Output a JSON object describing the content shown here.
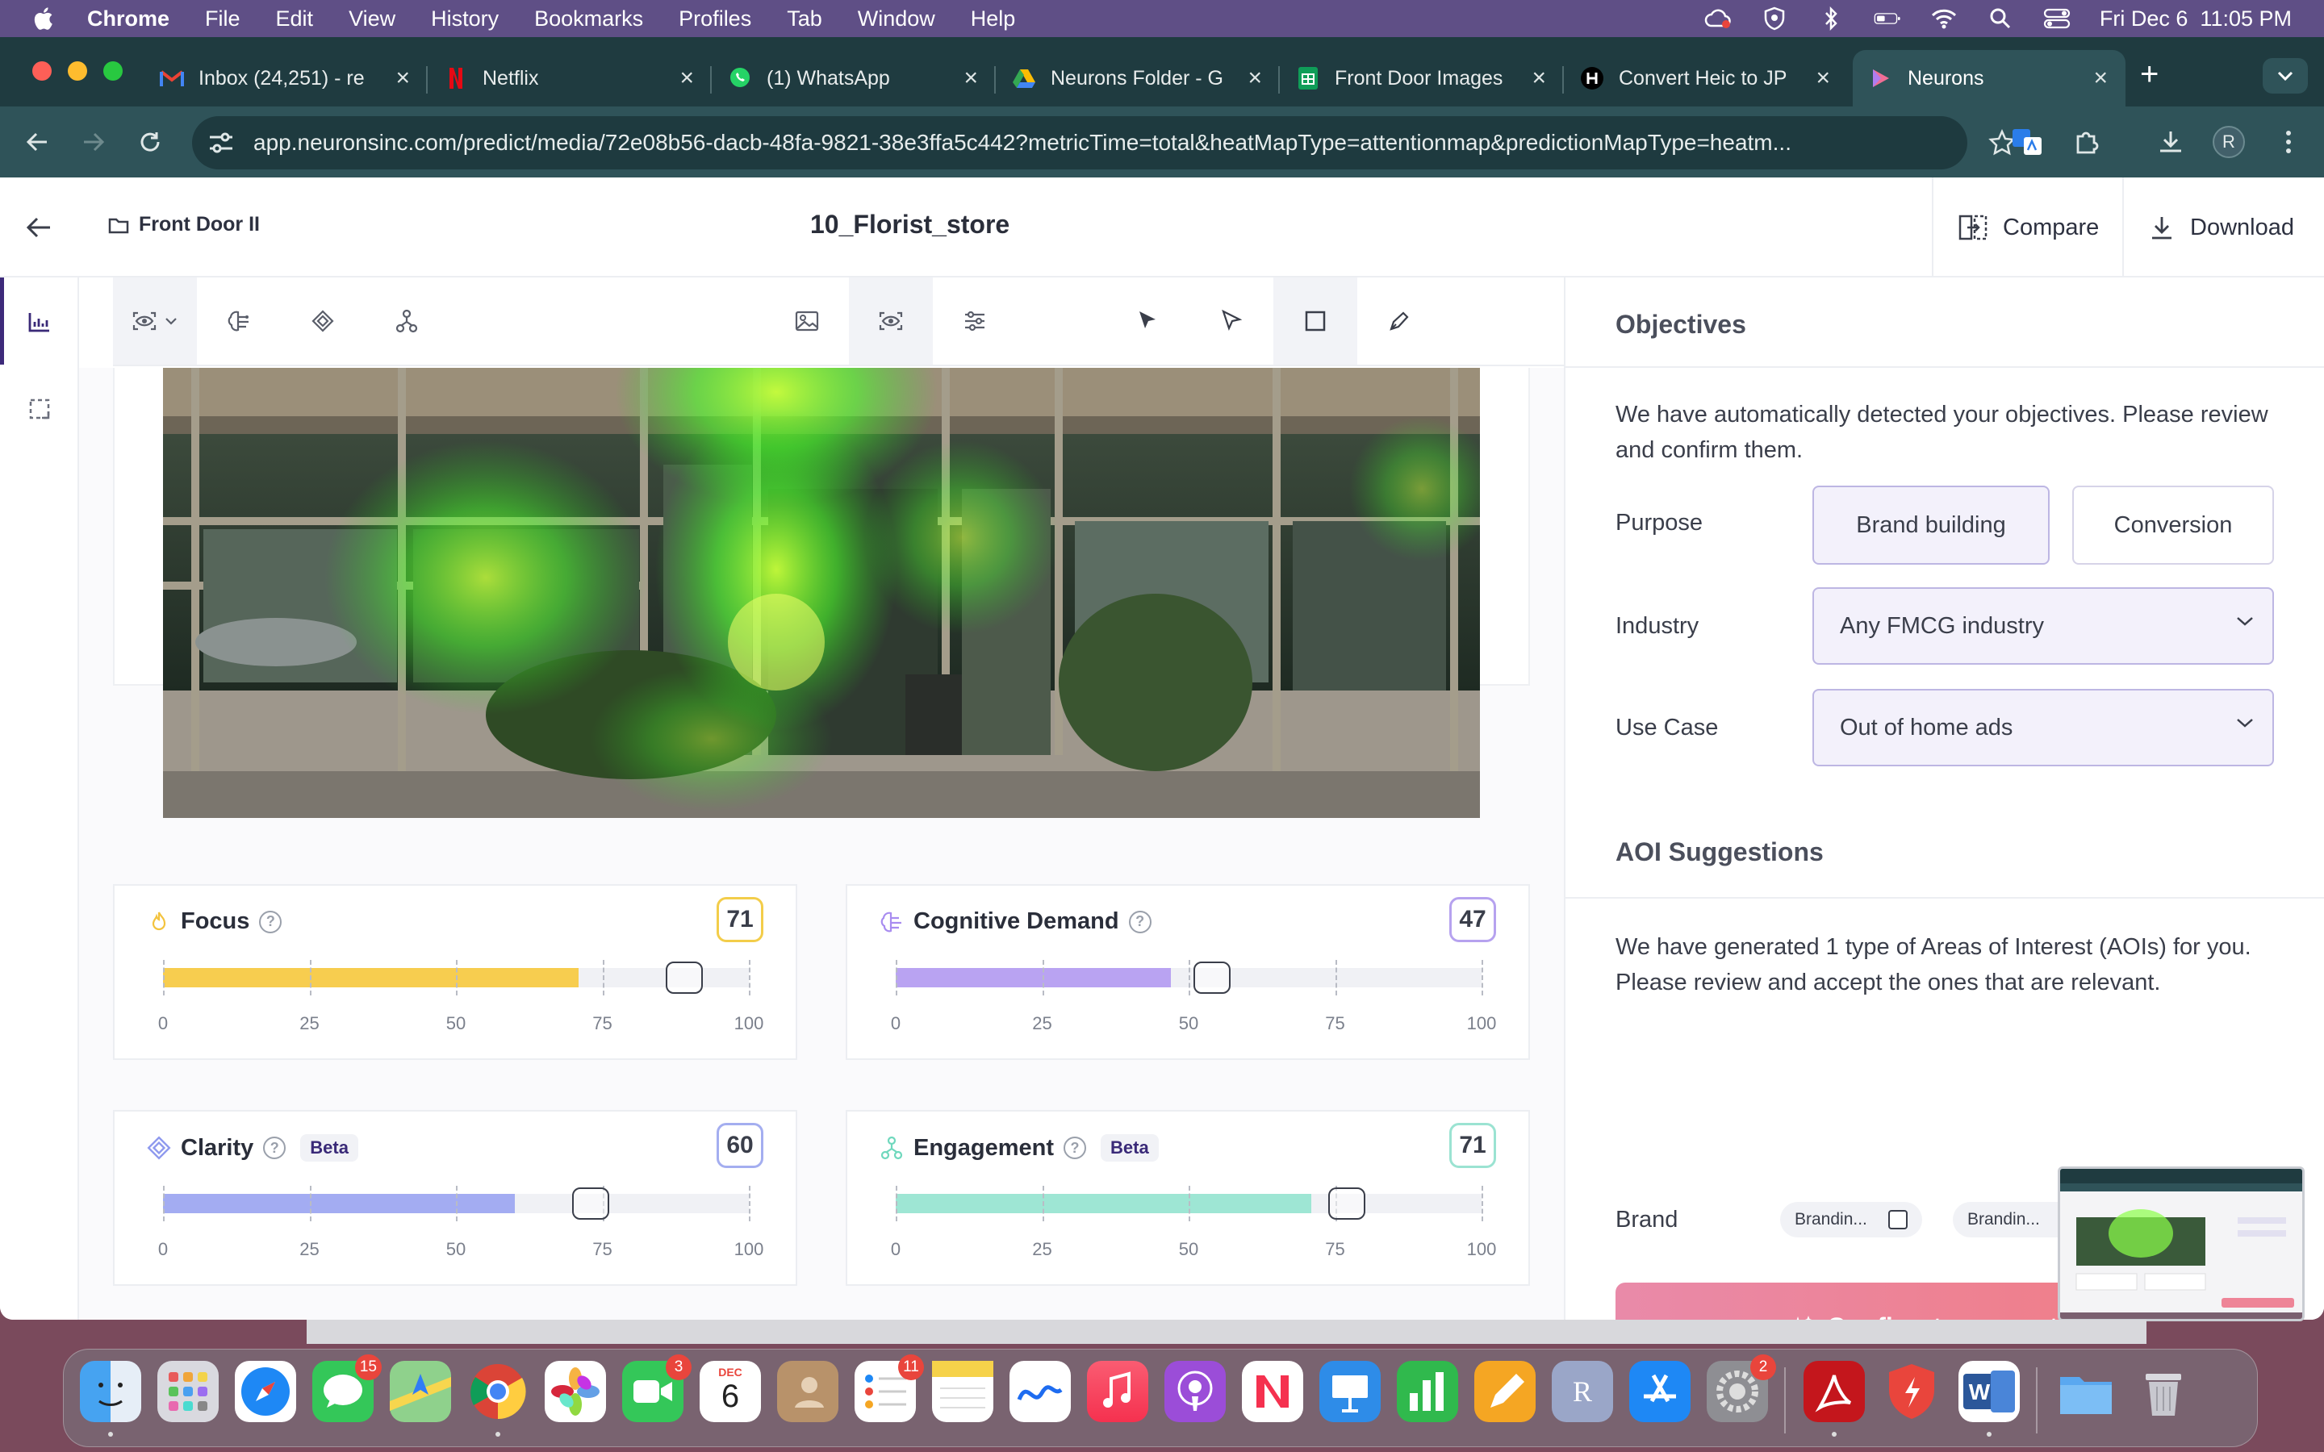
{
  "menubar": {
    "items": [
      "Chrome",
      "File",
      "Edit",
      "View",
      "History",
      "Bookmarks",
      "Profiles",
      "Tab",
      "Window",
      "Help"
    ],
    "clock": "Fri Dec 6  11:05 PM"
  },
  "tabs": [
    {
      "title": "Inbox (24,251) - re",
      "icon": "gmail-icon"
    },
    {
      "title": "Netflix",
      "icon": "netflix-icon"
    },
    {
      "title": "(1) WhatsApp",
      "icon": "whatsapp-icon"
    },
    {
      "title": "Neurons Folder - G",
      "icon": "google-drive-icon"
    },
    {
      "title": "Front Door Images",
      "icon": "google-sheets-icon"
    },
    {
      "title": "Convert Heic to JP",
      "icon": "heic-icon"
    },
    {
      "title": "Neurons",
      "icon": "neurons-icon"
    }
  ],
  "omnibox": {
    "url": "app.neuronsinc.com/predict/media/72e08b56-dacb-48fa-9821-38e3ffa5c442?metricTime=total&heatMapType=attentionmap&predictionMapType=heatm..."
  },
  "profile_initial": "R",
  "header": {
    "breadcrumb": "Front Door II",
    "title": "10_Florist_store",
    "compare_label": "Compare",
    "download_label": "Download"
  },
  "metrics": [
    {
      "name": "Focus",
      "score": "71",
      "value": 71,
      "handle": 89,
      "beta": "",
      "color": "#f7cd4f",
      "border": "#f3cd4a"
    },
    {
      "name": "Cognitive Demand",
      "score": "47",
      "value": 47,
      "handle": 54,
      "beta": "",
      "color": "#b9a3f2",
      "border": "#b6a2ef"
    },
    {
      "name": "Clarity",
      "score": "60",
      "value": 60,
      "handle": 73,
      "beta": "Beta",
      "color": "#a3acf2",
      "border": "#a4aef0"
    },
    {
      "name": "Engagement",
      "score": "71",
      "value": 71,
      "handle": 77,
      "beta": "Beta",
      "color": "#9ee6d4",
      "border": "#9be3d2"
    }
  ],
  "scale_labels": [
    "0",
    "25",
    "50",
    "75",
    "100"
  ],
  "objectives": {
    "title": "Objectives",
    "intro": "We have automatically detected your objectives. Please review and confirm them.",
    "purpose_label": "Purpose",
    "purpose_options": [
      "Brand building",
      "Conversion"
    ],
    "purpose_selected": "Brand building",
    "industry_label": "Industry",
    "industry_value": "Any FMCG industry",
    "usecase_label": "Use Case",
    "usecase_value": "Out of home ads"
  },
  "aoi": {
    "title": "AOI Suggestions",
    "intro": "We have generated 1 type of Areas of Interest (AOIs) for you. Please review and accept the ones that are relevant.",
    "brand_label": "Brand",
    "chips": [
      "Brandin...",
      "Brandin..."
    ],
    "confirm_label": "Confirm to generate i"
  },
  "help_label": "?",
  "dock_badges": {
    "messages": "15",
    "facetime": "3",
    "calendar_month": "DEC",
    "calendar_day": "6",
    "reminders": "11",
    "settings": "2"
  },
  "colors": {
    "accent": "#3a2a78",
    "chrome_tab": "#2f5359",
    "menubar": "#5f4f86",
    "confirm_start": "#e98aa9",
    "confirm_end": "#f27a7e"
  }
}
